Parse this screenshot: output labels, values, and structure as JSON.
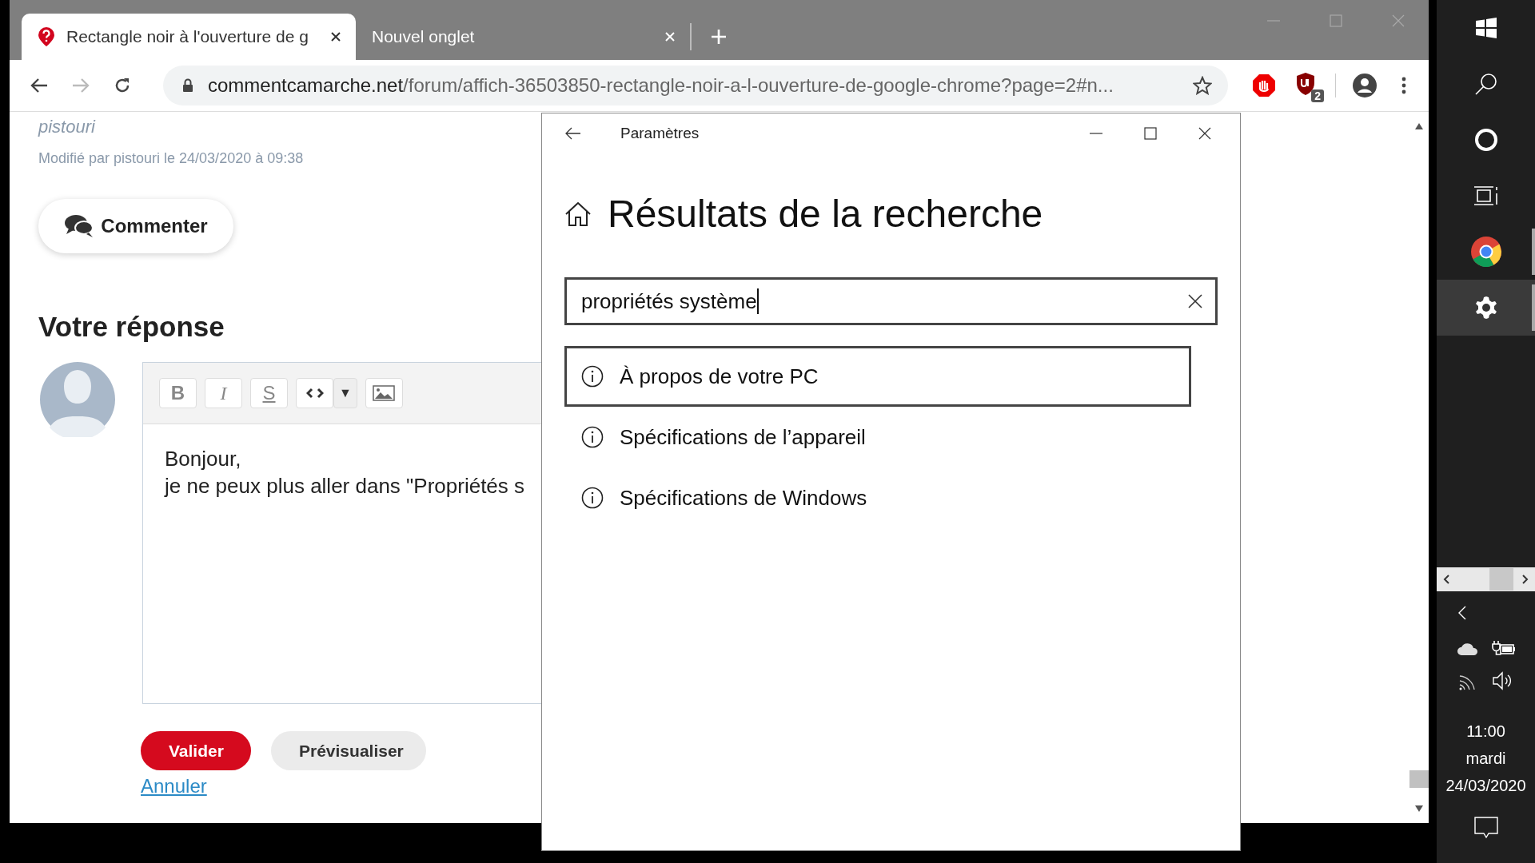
{
  "browser": {
    "tabs": [
      {
        "title": "Rectangle noir à l'ouverture de g",
        "selected": true
      },
      {
        "title": "Nouvel onglet",
        "selected": false
      }
    ],
    "address": {
      "host": "commentcamarche.net",
      "path": "/forum/affich-36503850-rectangle-noir-a-l-ouverture-de-google-chrome?page=2#n..."
    },
    "extension_badge": "2"
  },
  "page": {
    "author": "pistouri",
    "modified": "Modifié par pistouri le 24/03/2020 à 09:38",
    "comment_button": "Commenter",
    "reply_heading": "Votre réponse",
    "editor": {
      "toolbar": [
        {
          "kind": "bold",
          "label": "B"
        },
        {
          "kind": "italic",
          "label": "I"
        },
        {
          "kind": "strike",
          "label": "S"
        },
        {
          "kind": "code"
        },
        {
          "kind": "dropdown",
          "label": "▼"
        },
        {
          "kind": "image"
        }
      ],
      "lines": [
        "Bonjour,",
        "je ne peux plus aller dans \"Propriétés s"
      ]
    },
    "buttons": [
      {
        "label": "Valider",
        "kind": "primary"
      },
      {
        "label": "Prévisualiser",
        "kind": "secondary"
      }
    ],
    "cancel_link": "Annuler"
  },
  "settings": {
    "title": "Paramètres",
    "heading": "Résultats de la recherche",
    "search": {
      "value": "propriétés système"
    },
    "results": [
      {
        "label": "À propos de votre PC",
        "selected": true
      },
      {
        "label": "Spécifications de l’appareil",
        "selected": false
      },
      {
        "label": "Spécifications de Windows",
        "selected": false
      }
    ]
  },
  "taskbar": {
    "apps": [
      {
        "kind": "start",
        "running": false,
        "selected": false
      },
      {
        "kind": "search",
        "running": false,
        "selected": false
      },
      {
        "kind": "cortana",
        "running": false,
        "selected": false
      },
      {
        "kind": "taskview",
        "running": false,
        "selected": false
      },
      {
        "kind": "chrome",
        "running": true,
        "selected": false
      },
      {
        "kind": "settings",
        "running": true,
        "selected": true
      }
    ],
    "time": "11:00",
    "day": "mardi",
    "date": "24/03/2020"
  }
}
